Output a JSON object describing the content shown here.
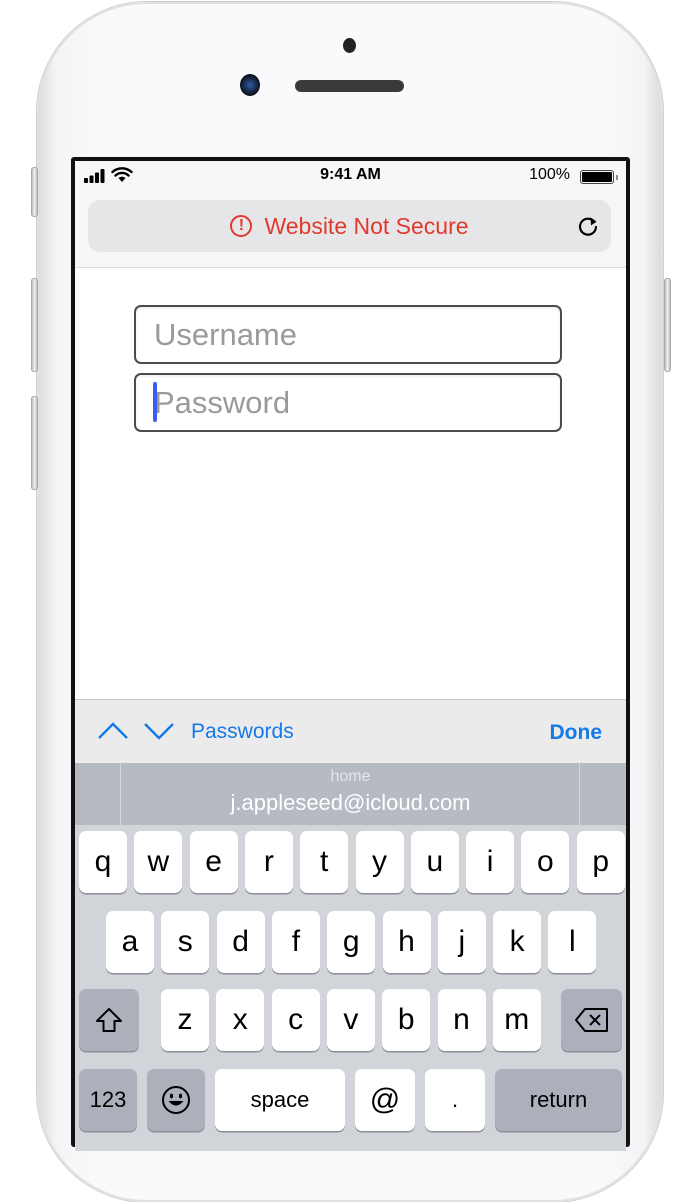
{
  "device": {
    "model": "iPhone"
  },
  "status_bar": {
    "time": "9:41 AM",
    "battery_percent": "100%",
    "battery_level": 1.0,
    "signal_bars": 4,
    "wifi": true
  },
  "url_bar": {
    "warning_text": "Website Not Secure",
    "warning_color": "#e03a2f",
    "warning_icon": "exclamation-circle-icon",
    "reload_icon": "reload-icon"
  },
  "form": {
    "username": {
      "placeholder": "Username",
      "value": ""
    },
    "password": {
      "placeholder": "Password",
      "value": "",
      "focused": true
    }
  },
  "accessory_bar": {
    "prev_icon": "chevron-up-icon",
    "next_icon": "chevron-down-icon",
    "passwords_label": "Passwords",
    "done_label": "Done",
    "accent_color": "#1579e8"
  },
  "suggestion": {
    "label": "home",
    "value": "j.appleseed@icloud.com"
  },
  "keyboard": {
    "row1": [
      "q",
      "w",
      "e",
      "r",
      "t",
      "y",
      "u",
      "i",
      "o",
      "p"
    ],
    "row2": [
      "a",
      "s",
      "d",
      "f",
      "g",
      "h",
      "j",
      "k",
      "l"
    ],
    "row3": [
      "z",
      "x",
      "c",
      "v",
      "b",
      "n",
      "m"
    ],
    "shift_icon": "shift-icon",
    "delete_icon": "delete-icon",
    "numbers_label": "123",
    "emoji_icon": "emoji-icon",
    "space_label": "space",
    "at_label": "@",
    "dot_label": ".",
    "return_label": "return"
  }
}
